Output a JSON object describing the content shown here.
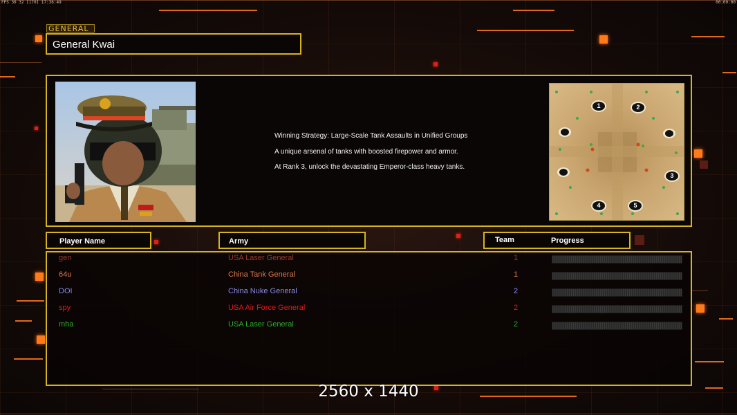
{
  "hud": {
    "top_left": "FPS 30 32 [170] 17:36:49",
    "top_right": "00:00:00"
  },
  "general": {
    "label": "GENERAL",
    "name": "General Kwai",
    "description": [
      "Winning Strategy: Large-Scale Tank Assaults in Unified Groups",
      "A unique arsenal of tanks with boosted firepower and armor.",
      "At Rank 3, unlock the devastating Emperor-class heavy tanks."
    ]
  },
  "minimap": {
    "start_positions": [
      "1",
      "2",
      "3",
      "4",
      "5"
    ]
  },
  "columns": {
    "player_name": "Player Name",
    "army": "Army",
    "team": "Team",
    "progress": "Progress"
  },
  "players": [
    {
      "name": "gen",
      "army": "USA Laser General",
      "team": "1",
      "color": "#9a3a2a",
      "progress": 0
    },
    {
      "name": "64u",
      "army": "China Tank General",
      "team": "1",
      "color": "#e07a4a",
      "progress": 0
    },
    {
      "name": "DOI",
      "army": "China Nuke General",
      "team": "2",
      "color": "#8a8ae8",
      "progress": 0
    },
    {
      "name": "spy",
      "army": "USA Air Force General",
      "team": "2",
      "color": "#e01a1a",
      "progress": 0
    },
    {
      "name": "mha",
      "army": "USA Laser General",
      "team": "2",
      "color": "#2ab02a",
      "progress": 0
    }
  ],
  "footer": {
    "resolution": "2560 x 1440"
  }
}
